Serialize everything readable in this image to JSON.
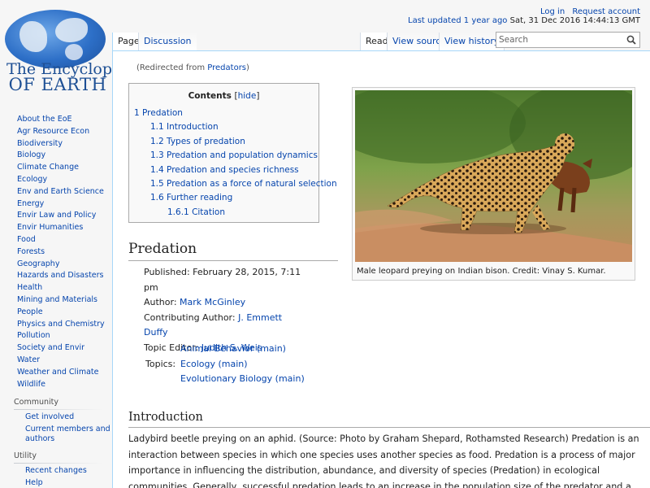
{
  "logo": {
    "line1": "The Encyclopedia",
    "line2": "OF EARTH"
  },
  "sidebar": {
    "nav": [
      "About the EoE",
      "Agr Resource Econ",
      "Biodiversity",
      "Biology",
      "Climate Change",
      "Ecology",
      "Env and Earth Science",
      "Energy",
      "Envir Law and Policy",
      "Envir Humanities",
      "Food",
      "Forests",
      "Geography",
      "Hazards and Disasters",
      "Health",
      "Mining and Materials",
      "People",
      "Physics and Chemistry",
      "Pollution",
      "Society and Envir",
      "Water",
      "Weather and Climate",
      "Wildlife"
    ],
    "community": {
      "heading": "Community",
      "items": [
        "Get involved",
        "Current members and authors"
      ]
    },
    "utility": {
      "heading": "Utility",
      "items": [
        "Recent changes",
        "Help"
      ]
    }
  },
  "personal": {
    "login": "Log in",
    "request": "Request account",
    "last_updated_link": "Last updated 1 year ago",
    "last_updated_time": "Sat, 31 Dec 2016 14:44:13 GMT"
  },
  "tabs": {
    "page": "Page",
    "discussion": "Discussion",
    "read": "Read",
    "source": "View source",
    "history": "View history"
  },
  "search": {
    "placeholder": "Search"
  },
  "redirect": {
    "prefix": "(Redirected from ",
    "link": "Predators",
    "suffix": ")"
  },
  "toc": {
    "title": "Contents",
    "hide_open": "[",
    "hide": "hide",
    "hide_close": "]",
    "items": [
      {
        "num": "1",
        "text": "Predation"
      },
      {
        "num": "1.1",
        "text": "Introduction"
      },
      {
        "num": "1.2",
        "text": "Types of predation"
      },
      {
        "num": "1.3",
        "text": "Predation and population dynamics"
      },
      {
        "num": "1.4",
        "text": "Predation and species richness"
      },
      {
        "num": "1.5",
        "text": "Predation as a force of natural selection"
      },
      {
        "num": "1.6",
        "text": "Further reading"
      },
      {
        "num": "1.6.1",
        "text": "Citation"
      }
    ]
  },
  "figure": {
    "caption": "Male leopard preying on Indian bison. Credit: Vinay S. Kumar."
  },
  "article": {
    "heading": "Predation",
    "published_label": "Published: February 28, 2015, 7:11",
    "published_cont": "pm",
    "author_label": "Author: ",
    "author": "Mark McGinley",
    "contrib_label": "Contributing Author: ",
    "contrib": "J. Emmett Duffy",
    "editor_label": "Topic Editor: ",
    "editor": "Judith S. Weis",
    "topics_label": "Topics:",
    "topics": [
      "Animal Behavior (main)",
      "Ecology (main)",
      "Evolutionary Biology (main)"
    ],
    "intro_heading": "Introduction",
    "intro_text": "Ladybird beetle preying on an aphid. (Source: Photo by Graham Shepard, Rothamsted Research) Predation is an interaction between species in which one species uses another species as food. Predation is a process of major importance in influencing the distribution, abundance, and diversity of species (Predation) in ecological communities. Generally, successful predation leads to an increase in the population size of the predator and a decrease in population size of the prey. These effects on the prey"
  }
}
